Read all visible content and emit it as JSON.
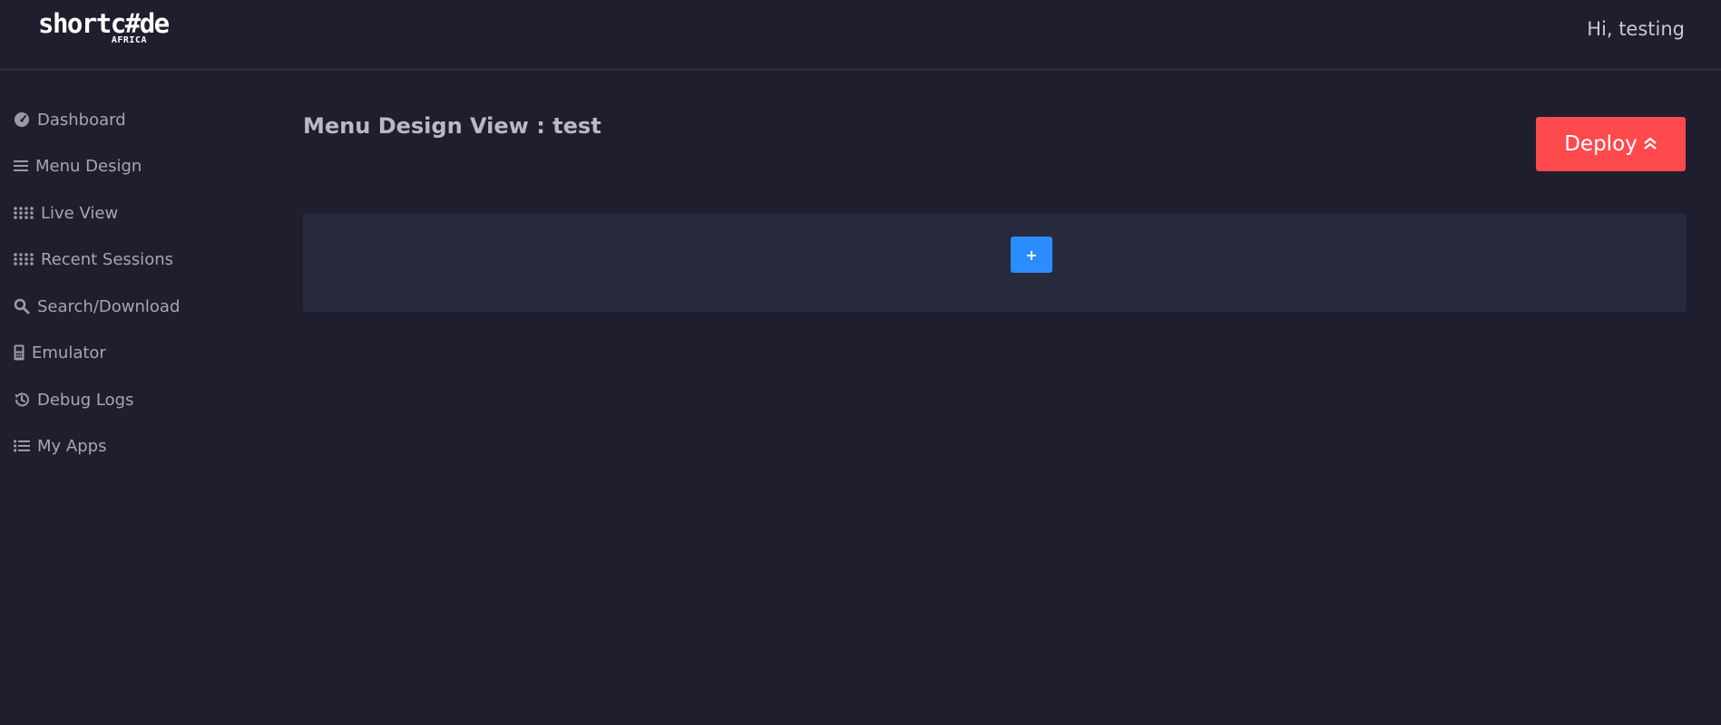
{
  "header": {
    "logo_main": "shortc#de",
    "logo_sub": "AFRICA",
    "greeting": "Hi, testing"
  },
  "sidebar": {
    "items": [
      {
        "label": "Dashboard",
        "icon": "gauge-icon"
      },
      {
        "label": "Menu Design",
        "icon": "bars-icon"
      },
      {
        "label": "Live View",
        "icon": "grid-dots-icon"
      },
      {
        "label": "Recent Sessions",
        "icon": "grid-dots-icon"
      },
      {
        "label": "Search/Download",
        "icon": "search-icon"
      },
      {
        "label": "Emulator",
        "icon": "phone-icon"
      },
      {
        "label": "Debug Logs",
        "icon": "history-icon"
      },
      {
        "label": "My Apps",
        "icon": "list-icon"
      }
    ]
  },
  "main": {
    "title": "Menu Design View : test",
    "deploy_label": "Deploy",
    "add_label": "+"
  },
  "colors": {
    "background": "#1e1e2e",
    "panel": "#272a3c",
    "deploy": "#ff4a4d",
    "add": "#2b8cff"
  }
}
